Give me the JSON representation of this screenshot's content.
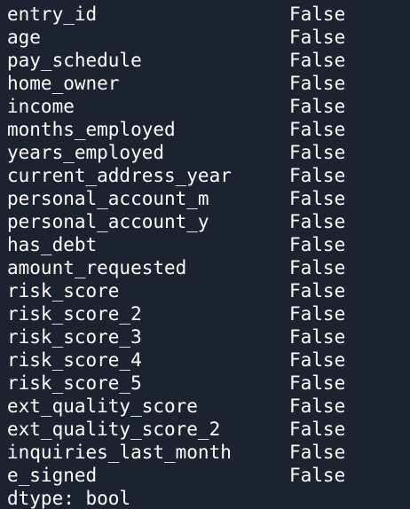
{
  "series": [
    {
      "name": "entry_id",
      "value": "False"
    },
    {
      "name": "age",
      "value": "False"
    },
    {
      "name": "pay_schedule",
      "value": "False"
    },
    {
      "name": "home_owner",
      "value": "False"
    },
    {
      "name": "income",
      "value": "False"
    },
    {
      "name": "months_employed",
      "value": "False"
    },
    {
      "name": "years_employed",
      "value": "False"
    },
    {
      "name": "current_address_year",
      "value": "False"
    },
    {
      "name": "personal_account_m",
      "value": "False"
    },
    {
      "name": "personal_account_y",
      "value": "False"
    },
    {
      "name": "has_debt",
      "value": "False"
    },
    {
      "name": "amount_requested",
      "value": "False"
    },
    {
      "name": "risk_score",
      "value": "False"
    },
    {
      "name": "risk_score_2",
      "value": "False"
    },
    {
      "name": "risk_score_3",
      "value": "False"
    },
    {
      "name": "risk_score_4",
      "value": "False"
    },
    {
      "name": "risk_score_5",
      "value": "False"
    },
    {
      "name": "ext_quality_score",
      "value": "False"
    },
    {
      "name": "ext_quality_score_2",
      "value": "False"
    },
    {
      "name": "inquiries_last_month",
      "value": "False"
    },
    {
      "name": "e_signed",
      "value": "False"
    }
  ],
  "dtype_line": "dtype: bool",
  "colors": {
    "background": "#1c2330",
    "text": "#ffffff"
  }
}
